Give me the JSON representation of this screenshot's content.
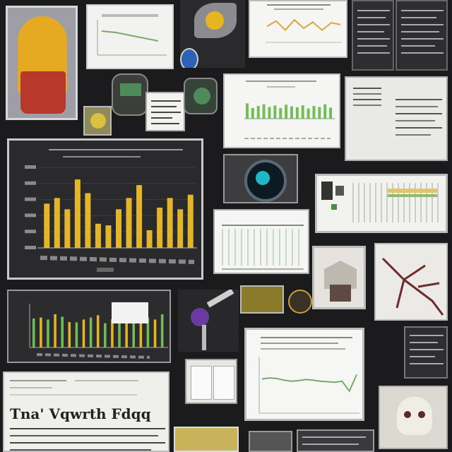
{
  "collage": {
    "headline": "Tna' Vqwrth Fdqq",
    "colors": {
      "background": "#1b1b1d",
      "bar_gold": "#e3b52b",
      "bar_green": "#6fbf55",
      "line_green": "#7aa86a",
      "accent_red": "#b8392c"
    }
  },
  "chart_data": [
    {
      "type": "bar",
      "series": [
        {
          "values": [
            55,
            62,
            48,
            85,
            68,
            30,
            28,
            48,
            62,
            78,
            22,
            50,
            62,
            48,
            66
          ]
        }
      ],
      "grid": true
    },
    {
      "type": "bar",
      "series": [
        {
          "values": [
            72,
            50,
            60,
            68,
            55,
            62,
            50,
            66,
            58,
            54,
            63,
            48,
            60,
            55,
            68,
            52
          ]
        }
      ]
    },
    {
      "type": "line",
      "series": [
        {
          "values": [
            62,
            64,
            63,
            60,
            58,
            59,
            61,
            60,
            58,
            57,
            56,
            58,
            40,
            70
          ]
        }
      ]
    },
    {
      "type": "line",
      "series": [
        {
          "values": [
            40,
            55,
            30,
            58,
            35,
            52,
            30,
            50,
            45
          ]
        }
      ]
    }
  ]
}
